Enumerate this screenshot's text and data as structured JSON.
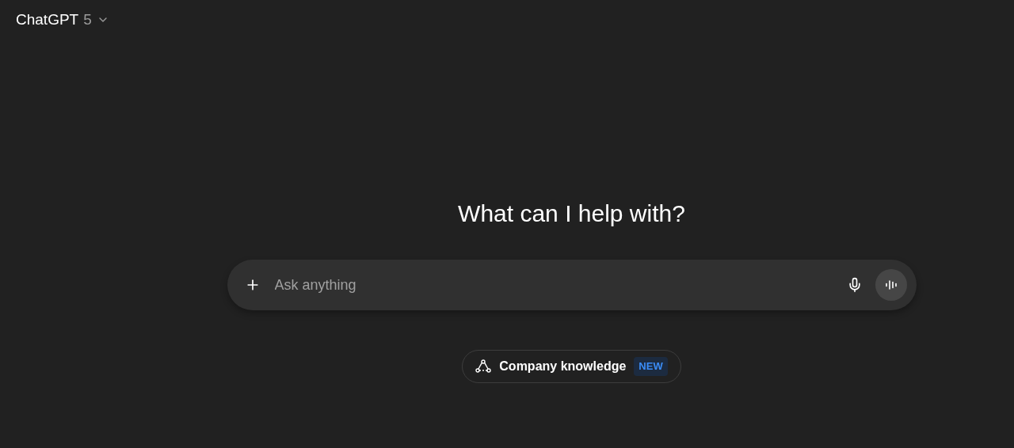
{
  "header": {
    "title": "ChatGPT",
    "version": "5"
  },
  "heading": "What can I help with?",
  "composer": {
    "placeholder": "Ask anything"
  },
  "chip": {
    "label": "Company knowledge",
    "badge": "NEW"
  }
}
